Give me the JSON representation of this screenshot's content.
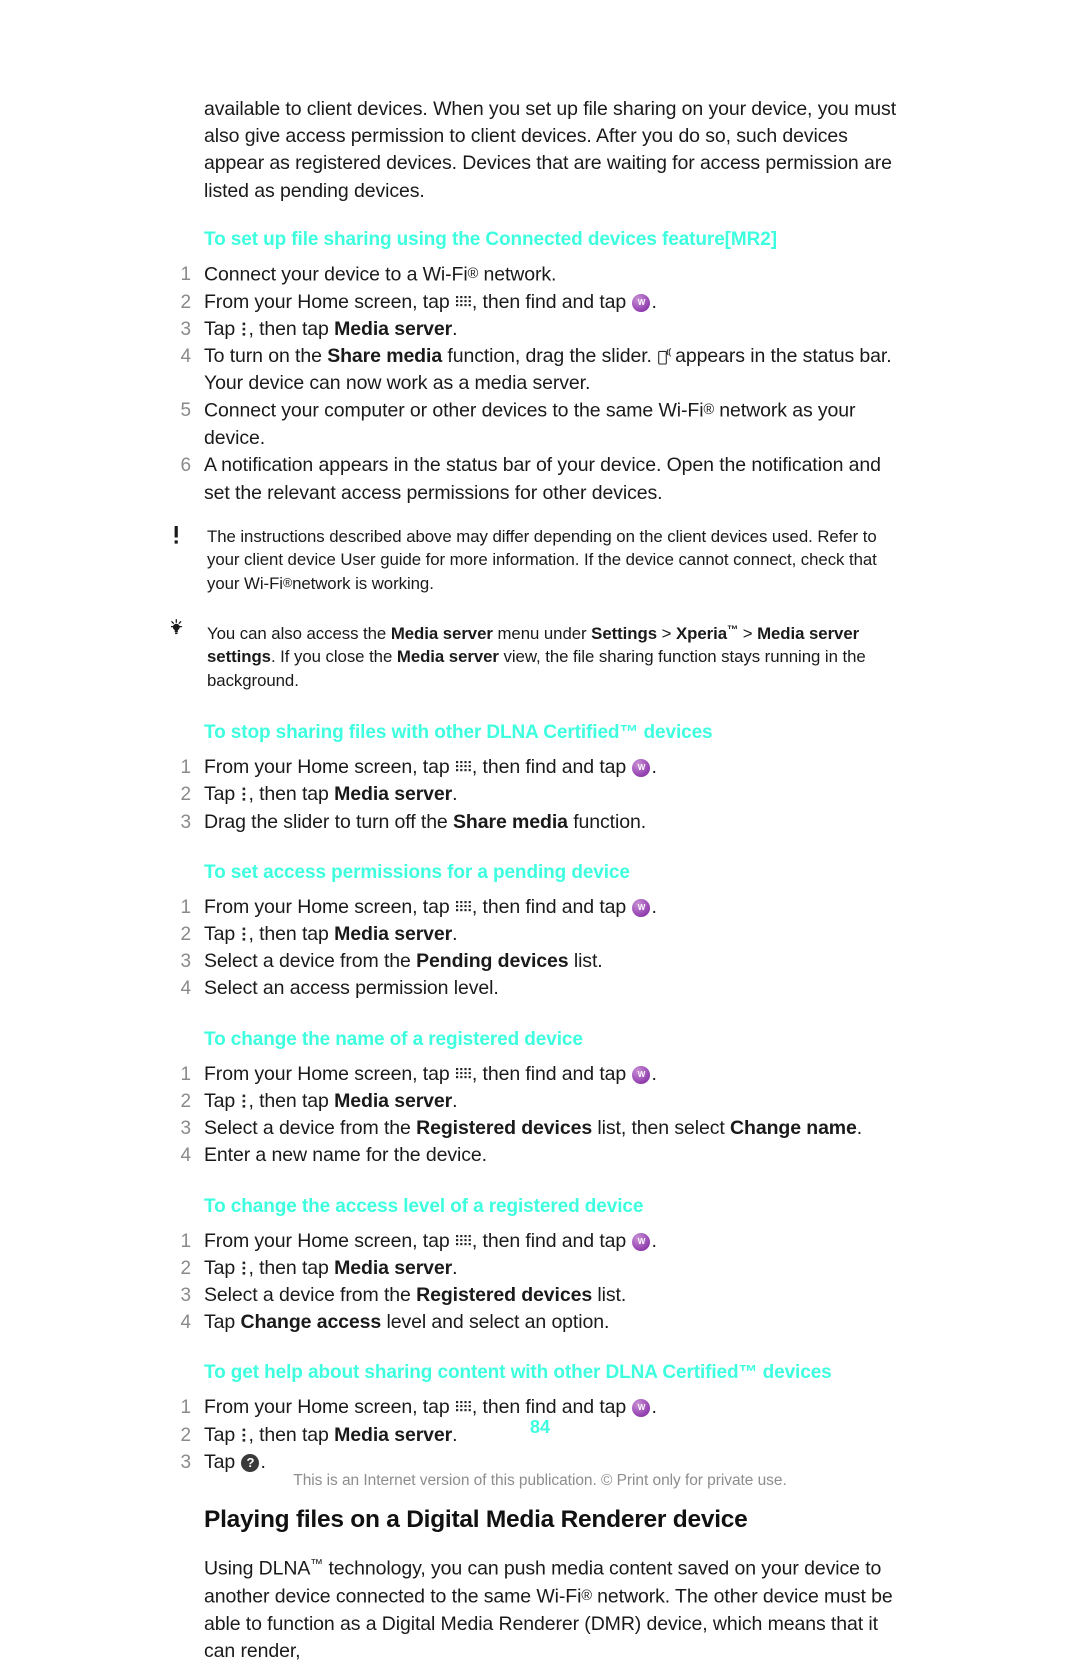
{
  "document": {
    "page_number": "84",
    "footer_note": "This is an Internet version of this publication. © Print only for private use."
  },
  "intro_paragraph": "available to client devices. When you set up file sharing on your device, you must also give access permission to client devices. After you do so, such devices appear as registered devices. Devices that are waiting for access permission are listed as pending devices.",
  "sections": [
    {
      "heading": "To set up file sharing using the Connected devices feature[MR2]",
      "steps": [
        "Connect your device to a Wi-Fi® network.",
        "From your Home screen, tap [app-grid-icon], then find and tap [walkman-icon].",
        "Tap [kebab-menu-icon], then tap Media server.",
        "To turn on the Share media function, drag the slider. [cast-icon] appears in the status bar. Your device can now work as a media server.",
        "Connect your computer or other devices to the same Wi-Fi® network as your device.",
        "A notification appears in the status bar of your device. Open the notification and set the relevant access permissions for other devices."
      ]
    },
    {
      "heading": "To stop sharing files with other DLNA Certified™ devices",
      "steps": [
        "From your Home screen, tap [app-grid-icon], then find and tap [walkman-icon].",
        "Tap [kebab-menu-icon], then tap Media server.",
        "Drag the slider to turn off the Share media function."
      ]
    },
    {
      "heading": "To set access permissions for a pending device",
      "steps": [
        "From your Home screen, tap [app-grid-icon], then find and tap [walkman-icon].",
        "Tap [kebab-menu-icon], then tap Media server.",
        "Select a device from the Pending devices list.",
        "Select an access permission level."
      ]
    },
    {
      "heading": "To change the name of a registered device",
      "steps": [
        "From your Home screen, tap [app-grid-icon], then find and tap [walkman-icon].",
        "Tap [kebab-menu-icon], then tap Media server.",
        "Select a device from the Registered devices list, then select Change name.",
        "Enter a new name for the device."
      ]
    },
    {
      "heading": "To change the access level of a registered device",
      "steps": [
        "From your Home screen, tap [app-grid-icon], then find and tap [walkman-icon].",
        "Tap [kebab-menu-icon], then tap Media server.",
        "Select a device from the Registered devices list.",
        "Tap Change access level and select an option."
      ]
    },
    {
      "heading": "To get help about sharing content with other DLNA Certified™ devices",
      "steps": [
        "From your Home screen, tap [app-grid-icon], then find and tap [walkman-icon].",
        "Tap [kebab-menu-icon], then tap Media server.",
        "Tap [help-icon]."
      ]
    }
  ],
  "note_callout": {
    "icon": "exclamation-icon",
    "text": "The instructions described above may differ depending on the client devices used. Refer to your client device User guide for more information. If the device cannot connect, check that your Wi-Fi®network is working."
  },
  "tip_callout": {
    "icon": "lightbulb-icon",
    "text": "You can also access the Media server menu under Settings > Xperia™ > Media server settings. If you close the Media server view, the file sharing function stays running in the background."
  },
  "final_section": {
    "heading": "Playing files on a Digital Media Renderer device",
    "paragraph": "Using DLNA™ technology, you can push media content saved on your device to another device connected to the same Wi-Fi® network. The other device must be able to function as a Digital Media Renderer (DMR) device, which means that it can render,"
  },
  "labels": {
    "step1_s1": "Connect your device to a Wi-Fi",
    "step1_s1_tail": " network.",
    "from_home": "From your Home screen, tap",
    "then_find_tap": ", then find and tap",
    "tap_word": "Tap",
    "then_tap": ", then tap",
    "media_server": "Media server",
    "period": ".",
    "s1_4_a": "To turn on the",
    "s1_4_b": "Share media",
    "s1_4_c": "function, drag the slider.",
    "s1_4_d": "appears in the status bar. Your device can now work as a media server.",
    "s1_5_a": "Connect your computer or other devices to the same Wi-Fi",
    "s1_5_b": " network as your device.",
    "s1_6": "A notification appears in the status bar of your device. Open the notification and set the relevant access permissions for other devices.",
    "s2_3_a": "Drag the slider to turn off the",
    "s2_3_b": "Share media",
    "s2_3_c": "function.",
    "s3_3_a": "Select a device from the",
    "s3_3_b": "Pending devices",
    "s3_3_c": "list.",
    "s3_4": "Select an access permission level.",
    "s4_3_a": "Select a device from the",
    "s4_3_b": "Registered devices",
    "s4_3_c": "list, then select",
    "s4_3_d": "Change name",
    "s4_4": "Enter a new name for the device.",
    "s5_3_a": "Select a device from the",
    "s5_3_b": "Registered devices",
    "s5_3_c": "list.",
    "s5_4_a": "Tap",
    "s5_4_b": "Change access",
    "s5_4_c": "level and select an option.",
    "s6_3": "Tap",
    "note_a": "The instructions described above may differ depending on the client devices used. Refer to your client device User guide for more information. If the device cannot connect, check that your Wi-Fi",
    "note_b": "network is working.",
    "tip_a": "You can also access the",
    "tip_b": "Media server",
    "tip_c": "menu under",
    "tip_d": "Settings",
    "tip_e": ">",
    "tip_f": "Xperia",
    "tip_g": ">",
    "tip_h": "Media server settings",
    "tip_i": ". If you close the",
    "tip_j": "Media server",
    "tip_k": "view, the file sharing function stays running in the background.",
    "final_a": "Using DLNA",
    "final_b": " technology, you can push media content saved on your device to another device connected to the same Wi-Fi",
    "final_c": " network. The other device must be able to function as a Digital Media Renderer (DMR) device, which means that it can render,"
  },
  "colors": {
    "heading_cyan": "#3dffdf",
    "step_number_gray": "#8a8a8a",
    "body_text": "#1a1a1a",
    "footer_gray": "#8d8d8d",
    "walkman_purple": "#a85fc0"
  }
}
